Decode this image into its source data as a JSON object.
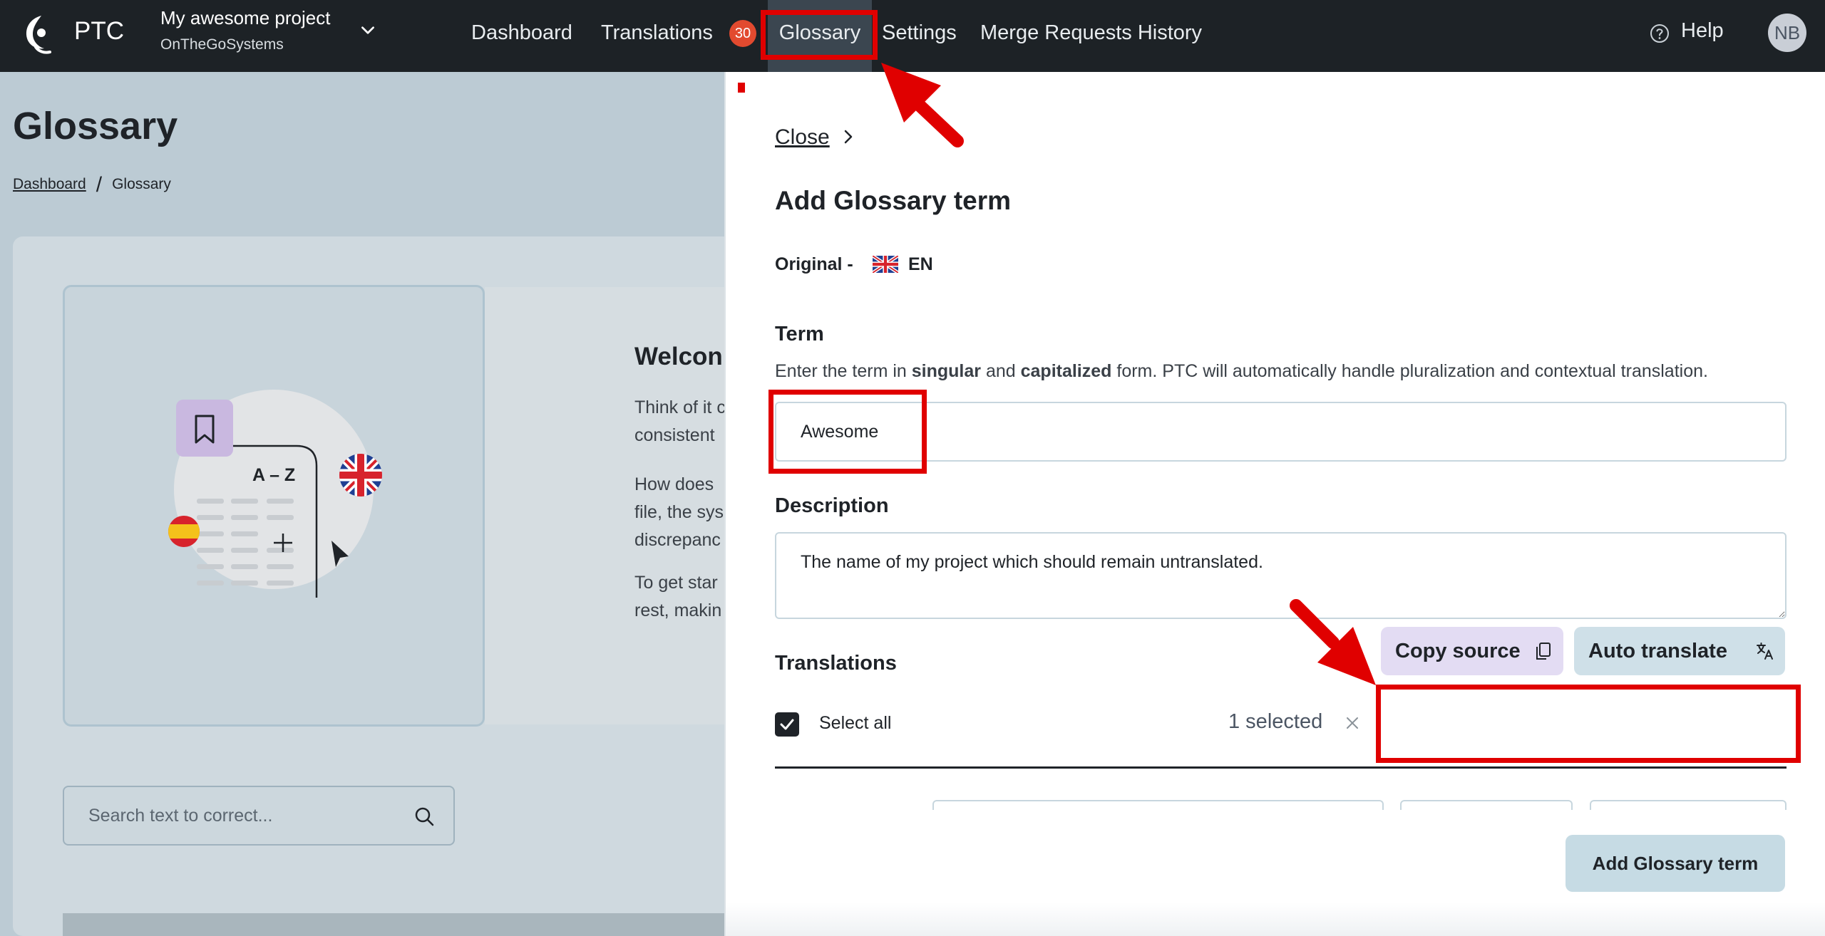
{
  "topbar": {
    "brand": "PTC",
    "project_name": "My awesome project",
    "project_org": "OnTheGoSystems",
    "nav": {
      "dashboard": "Dashboard",
      "translations": "Translations",
      "translations_badge": "30",
      "glossary": "Glossary",
      "settings": "Settings",
      "merge_requests": "Merge Requests History"
    },
    "help": "Help",
    "avatar_initials": "NB"
  },
  "page": {
    "title": "Glossary",
    "breadcrumb": {
      "link": "Dashboard",
      "current": "Glossary"
    },
    "welcome": {
      "title": "Welcon",
      "lines": [
        "Think of it c",
        "consistent",
        "How does",
        "file, the sys",
        "discrepanc",
        "To get star",
        "rest, makin"
      ]
    },
    "illustration": {
      "label": "A – Z"
    },
    "search": {
      "placeholder": "Search text to correct..."
    }
  },
  "drawer": {
    "close": "Close",
    "title": "Add Glossary term",
    "original_label": "Original -",
    "original_lang": "EN",
    "term": {
      "label": "Term",
      "hint_prefix": "Enter the term in ",
      "hint_bold1": "singular",
      "hint_mid": " and ",
      "hint_bold2": "capitalized",
      "hint_suffix": " form. PTC will automatically handle pluralization and contextual translation.",
      "value": "Awesome"
    },
    "description": {
      "label": "Description",
      "value": "The name of my project which should remain untranslated."
    },
    "translations": {
      "label": "Translations",
      "select_all": "Select all",
      "select_all_checked": true,
      "selected_count": "1 selected",
      "copy_source": "Copy source",
      "auto_translate": "Auto translate"
    },
    "submit": "Add Glossary term"
  },
  "colors": {
    "annotation": "#e00000",
    "topbar": "#1d2226",
    "badge": "#e24a2f",
    "copy_button": "#e3dcf3",
    "auto_button": "#cfe0e8"
  }
}
